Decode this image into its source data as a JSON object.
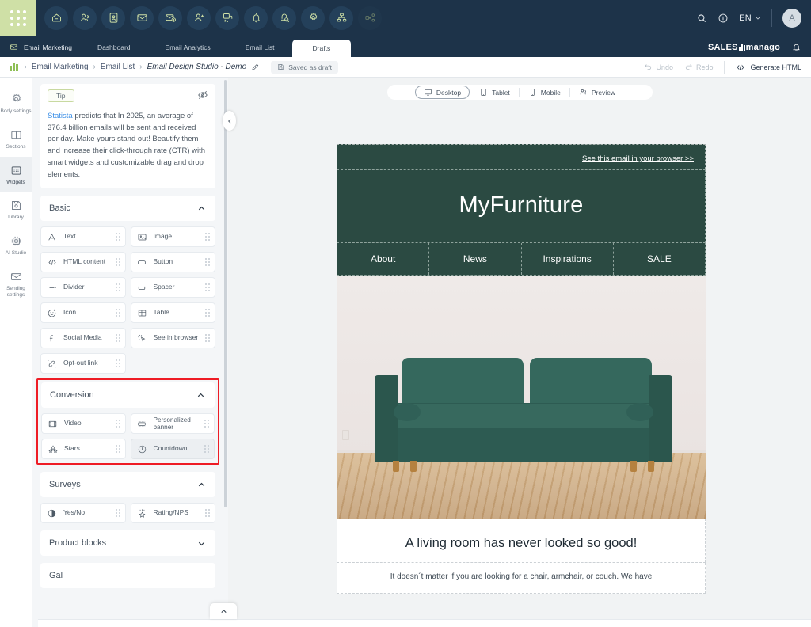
{
  "topbar": {
    "launcher_label": "apps-grid",
    "icons": [
      {
        "name": "home-icon"
      },
      {
        "name": "contacts-icon"
      },
      {
        "name": "contact-profile-icon"
      },
      {
        "name": "email-icon"
      },
      {
        "name": "email-add-icon"
      },
      {
        "name": "add-user-icon"
      },
      {
        "name": "web-push-icon"
      },
      {
        "name": "bell-icon"
      },
      {
        "name": "alert-search-icon"
      },
      {
        "name": "settings-gear-icon"
      },
      {
        "name": "hierarchy-icon"
      },
      {
        "name": "workflow-icon"
      }
    ],
    "search_icon": "search-icon",
    "info_icon": "info-icon",
    "language": "EN",
    "avatar_initial": "A"
  },
  "subnav": {
    "section_label": "Email Marketing",
    "items": [
      {
        "label": "Dashboard",
        "active": false
      },
      {
        "label": "Email Analytics",
        "active": false
      },
      {
        "label": "Email List",
        "active": false
      },
      {
        "label": "Drafts",
        "active": true
      }
    ],
    "brand": "SALES manago",
    "brand_prefix": "SALES",
    "brand_suffix": "manago",
    "bell_icon": "notification-bell-icon"
  },
  "breadcrumb": {
    "items": [
      "Email Marketing",
      "Email List"
    ],
    "current": "Email Design Studio - Demo",
    "edit_icon": "pencil-edit-icon",
    "saved_label": "Saved as draft",
    "saved_icon": "save-disk-icon",
    "undo_label": "Undo",
    "redo_label": "Redo",
    "generate_html_label": "Generate HTML",
    "code_icon": "code-brackets-icon"
  },
  "rail": {
    "items": [
      {
        "label": "Body settings",
        "icon": "gear-icon",
        "active": false
      },
      {
        "label": "Sections",
        "icon": "columns-icon",
        "active": false
      },
      {
        "label": "Widgets",
        "icon": "widgets-grid-icon",
        "active": true
      },
      {
        "label": "Library",
        "icon": "save-library-icon",
        "active": false
      },
      {
        "label": "AI Studio",
        "icon": "chip-ai-icon",
        "active": false
      },
      {
        "label": "Sending settings",
        "icon": "envelope-icon",
        "active": false
      }
    ]
  },
  "panel": {
    "tip": {
      "badge": "Tip",
      "hide_icon": "eye-off-icon",
      "link_text": "Statista",
      "text": " predicts that In 2025, an average of 376.4 billion emails will be sent and received per day. Make yours stand out! Beautify them and increase their click-through rate (CTR) with smart widgets and customizable drag and drop elements."
    },
    "groups": [
      {
        "title": "Basic",
        "expanded": true,
        "highlighted": false,
        "items": [
          {
            "label": "Text",
            "icon": "text-a-icon",
            "selected": false
          },
          {
            "label": "Image",
            "icon": "image-icon",
            "selected": false
          },
          {
            "label": "HTML content",
            "icon": "code-icon",
            "selected": false
          },
          {
            "label": "Button",
            "icon": "button-icon",
            "selected": false
          },
          {
            "label": "Divider",
            "icon": "divider-icon",
            "selected": false
          },
          {
            "label": "Spacer",
            "icon": "spacer-icon",
            "selected": false
          },
          {
            "label": "Icon",
            "icon": "smiley-plus-icon",
            "selected": false
          },
          {
            "label": "Table",
            "icon": "table-icon",
            "selected": false
          },
          {
            "label": "Social Media",
            "icon": "facebook-icon",
            "selected": false
          },
          {
            "label": "See in browser",
            "icon": "click-cursor-icon",
            "selected": false
          },
          {
            "label": "Opt-out link",
            "icon": "broken-link-icon",
            "selected": false
          }
        ]
      },
      {
        "title": "Conversion",
        "expanded": true,
        "highlighted": true,
        "items": [
          {
            "label": "Video",
            "icon": "film-video-icon",
            "selected": false
          },
          {
            "label": "Personalized banner",
            "icon": "banner-icon",
            "selected": false
          },
          {
            "label": "Stars",
            "icon": "stars-icon",
            "selected": false
          },
          {
            "label": "Countdown",
            "icon": "clock-countdown-icon",
            "selected": true
          }
        ]
      },
      {
        "title": "Surveys",
        "expanded": true,
        "highlighted": false,
        "items": [
          {
            "label": "Yes/No",
            "icon": "yes-no-circle-icon",
            "selected": false
          },
          {
            "label": "Rating/NPS",
            "icon": "rating-star-icon",
            "selected": false
          }
        ]
      },
      {
        "title": "Product blocks",
        "expanded": false,
        "highlighted": false,
        "items": []
      }
    ],
    "collapse_icon": "chevron-left-icon",
    "scroll_up_icon": "chevron-up-icon"
  },
  "canvas": {
    "devices": [
      {
        "label": "Desktop",
        "icon": "monitor-icon",
        "active": true
      },
      {
        "label": "Tablet",
        "icon": "tablet-icon",
        "active": false
      },
      {
        "label": "Mobile",
        "icon": "mobile-icon",
        "active": false
      },
      {
        "label": "Preview",
        "icon": "preview-people-icon",
        "active": false
      }
    ]
  },
  "email": {
    "browser_link": "See this email in your browser >>",
    "brand": "MyFurniture",
    "nav": [
      "About",
      "News",
      "Inspirations",
      "SALE"
    ],
    "hero_image_alt": "green-velvet-sofa-photo",
    "headline": "A living room has never looked so good!",
    "body": "It doesn´t matter if you are looking for a chair, armchair, or couch. We have",
    "colors": {
      "brand_green": "#2b4a42",
      "accent_red": "#ee1c25",
      "topbar_navy": "#1d3349",
      "launcher_green": "#cfe0a6"
    }
  }
}
